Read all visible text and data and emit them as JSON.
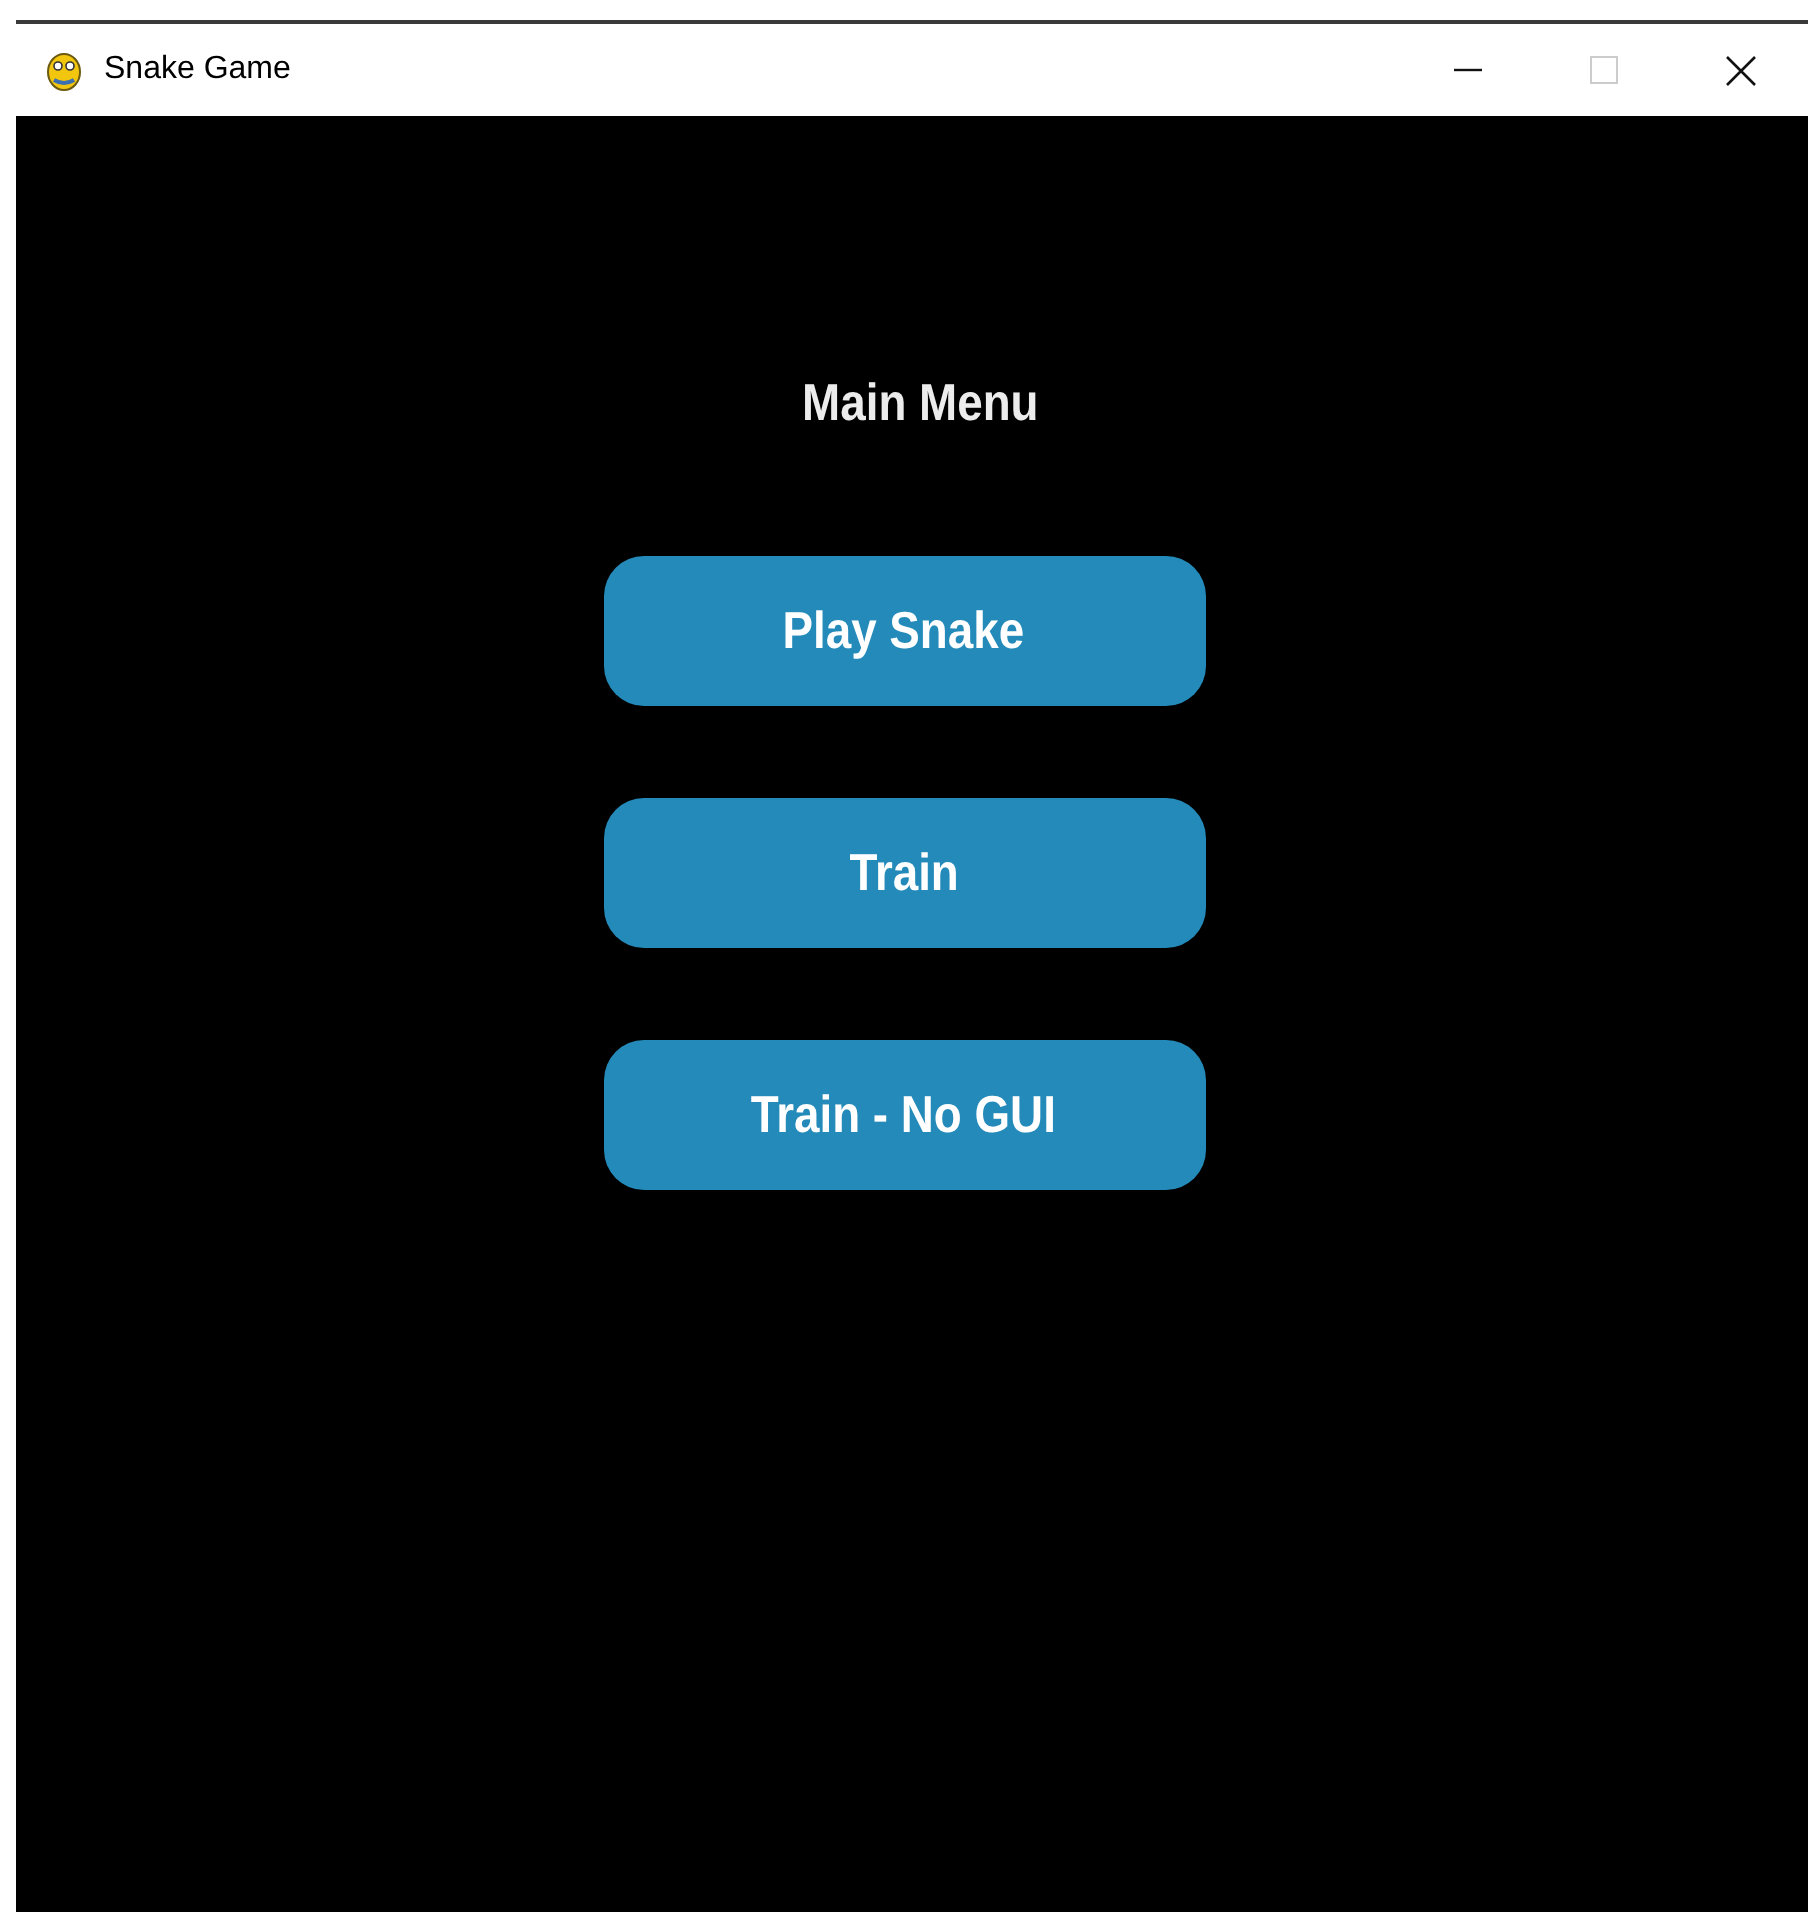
{
  "window": {
    "title": "Snake Game",
    "controls": [
      {
        "kind": "minimize",
        "disabled": false
      },
      {
        "kind": "maximize",
        "disabled": true
      },
      {
        "kind": "close",
        "disabled": false
      }
    ]
  },
  "heading": "Main Menu",
  "buttons": [
    {
      "label": "Play Snake"
    },
    {
      "label": "Train"
    },
    {
      "label": "Train - No GUI"
    }
  ]
}
